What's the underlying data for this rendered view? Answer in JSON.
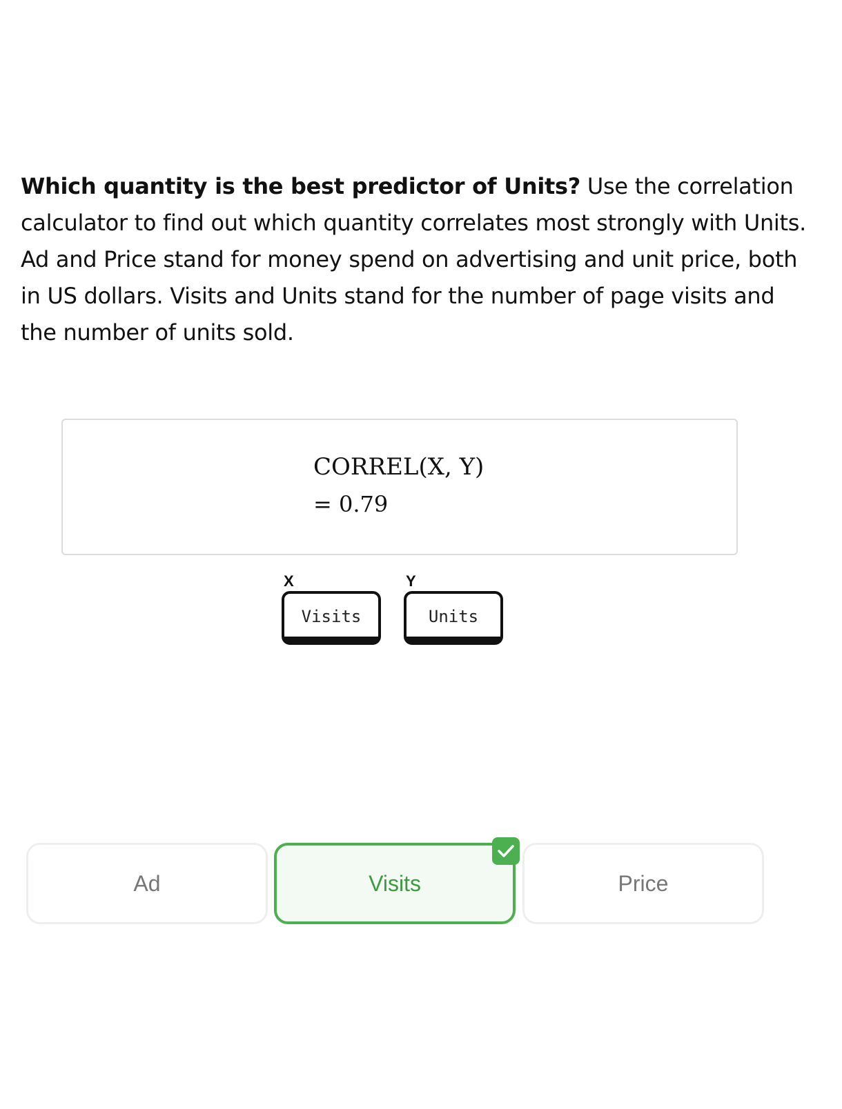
{
  "question": {
    "lead": "Which quantity is the best predictor of Units?",
    "body": " Use the correlation calculator to find out which quantity correlates most strongly with Units. Ad and Price stand for money spend on advertising and unit price, both in US dollars. Visits and Units stand for the number of page visits and the number of units sold."
  },
  "calculator": {
    "formula": "CORREL(X, Y)",
    "result": "= 0.79",
    "x_label": "X",
    "y_label": "Y",
    "x_value": "Visits",
    "y_value": "Units"
  },
  "options": [
    {
      "label": "Ad",
      "selected": false
    },
    {
      "label": "Visits",
      "selected": true
    },
    {
      "label": "Price",
      "selected": false
    }
  ],
  "colors": {
    "selected_border": "#4caf50",
    "selected_text": "#3e9a42",
    "selected_background": "#f3f9f3"
  },
  "icons": {
    "selected_badge": "checkmark-icon"
  }
}
